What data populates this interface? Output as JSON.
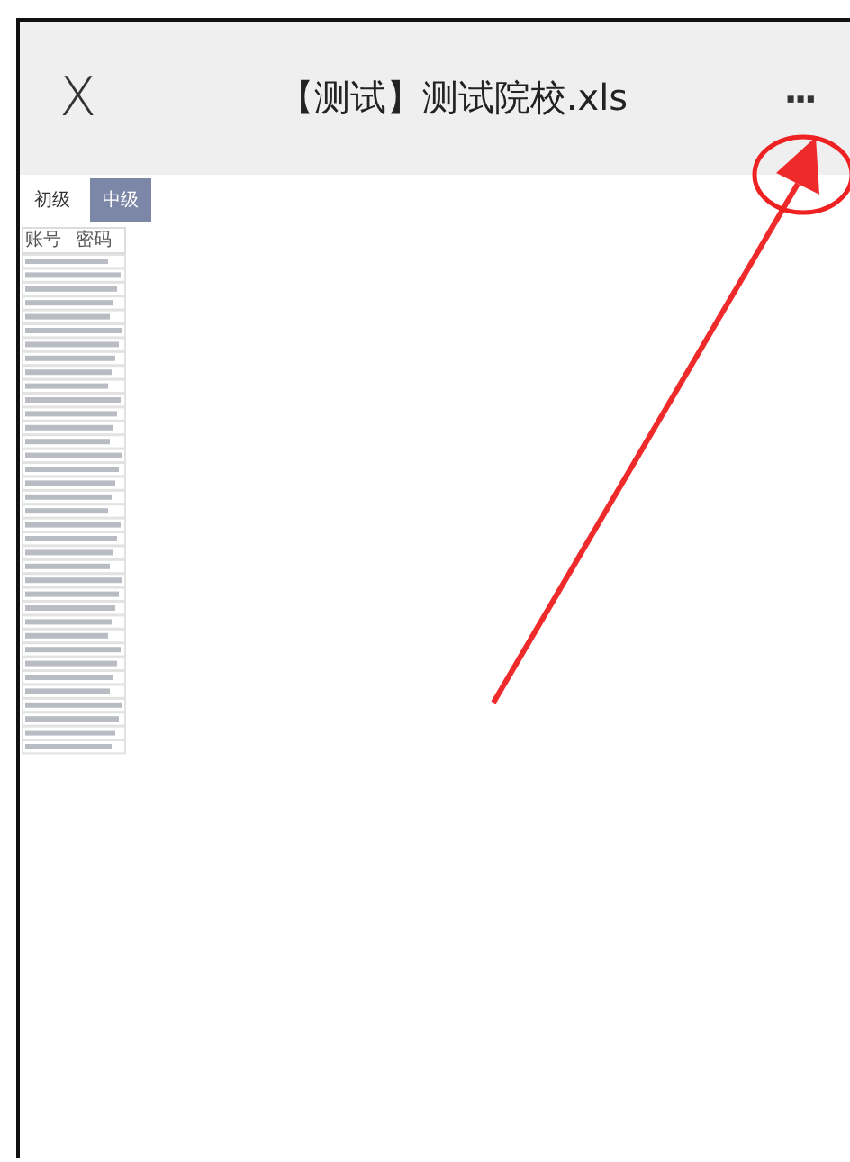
{
  "header": {
    "close_icon": "X",
    "title": "【测试】测试院校.xls",
    "more_icon": "···"
  },
  "sheet_tabs": [
    {
      "label": "初级",
      "selected": false
    },
    {
      "label": "中级",
      "selected": true
    }
  ],
  "table": {
    "columns": [
      "账号",
      "密码"
    ]
  }
}
